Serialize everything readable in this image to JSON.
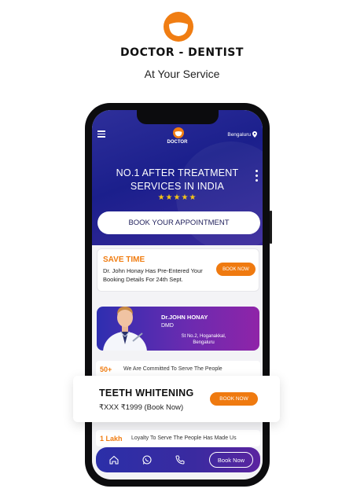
{
  "brand": {
    "title": "DOCTOR - DENTIST",
    "subtitle": "At Your Service",
    "accent_color": "#f07d12"
  },
  "app": {
    "header": {
      "name": "DOCTOR",
      "city": "Bengaluru",
      "menu_icon": "hamburger-icon",
      "location_icon": "map-pin-icon",
      "more_icon": "kebab-icon"
    },
    "hero": {
      "title_line1": "NO.1 AFTER TREATMENT",
      "title_line2": "SERVICES IN INDIA",
      "rating_stars": "★★★★★",
      "book_button": "BOOK YOUR APPOINTMENT"
    },
    "save_time": {
      "title": "SAVE TIME",
      "description": "Dr. John Honay Has Pre-Entered Your Booking Details For 24th Sept.",
      "button": "BOOK NOW"
    },
    "doctor": {
      "name": "Dr.JOHN HONAY",
      "degree": "DMD",
      "address": "St No.2, Hoganakkal, Bengaluru"
    },
    "stats": [
      {
        "number": "50+",
        "text": "We Are Committed To Serve The People"
      },
      {
        "number": "1 Lakh",
        "text": "Loyalty To Serve The People Has Made Us"
      }
    ],
    "bottom_nav": {
      "icons": [
        "home-icon",
        "whatsapp-icon",
        "phone-icon"
      ],
      "book_button": "Book Now"
    }
  },
  "promo": {
    "title": "TEETH WHITENING",
    "price": "₹XXX ₹1999  (Book Now)",
    "button": "BOOK NOW"
  }
}
